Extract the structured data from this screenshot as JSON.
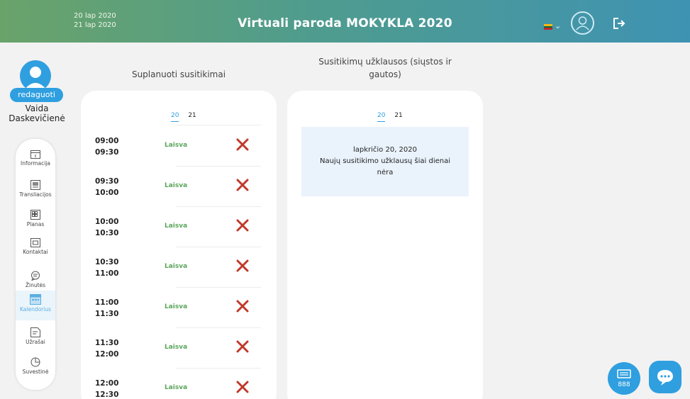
{
  "header": {
    "date_start": "20 lap 2020",
    "date_end": "21 lap 2020",
    "title": "Virtuali paroda MOKYKLA 2020",
    "lang_icon": "lithuania-flag-icon",
    "lang_chevron": "⌄"
  },
  "profile": {
    "edit_label": "redaguoti",
    "first_name": "Vaida",
    "last_name": "Daskevičienė"
  },
  "sidebar": {
    "items": [
      {
        "label": "Informacija",
        "icon": "info-icon"
      },
      {
        "label": "Transliacijos",
        "icon": "broadcast-icon"
      },
      {
        "label": "Planas",
        "icon": "plan-icon"
      },
      {
        "label": "Kontaktai",
        "icon": "contacts-icon"
      },
      {
        "label": "Žinutės",
        "icon": "messages-icon"
      },
      {
        "label": "Kalendorius",
        "icon": "calendar-icon"
      },
      {
        "label": "Užrašai",
        "icon": "notes-icon"
      },
      {
        "label": "Suvestinė",
        "icon": "summary-icon"
      }
    ]
  },
  "scheduled": {
    "title": "Suplanuoti susitikimai",
    "tabs": [
      "20",
      "21"
    ],
    "slots": [
      {
        "start": "09:00",
        "end": "09:30",
        "status": "Laisva"
      },
      {
        "start": "09:30",
        "end": "10:00",
        "status": "Laisva"
      },
      {
        "start": "10:00",
        "end": "10:30",
        "status": "Laisva"
      },
      {
        "start": "10:30",
        "end": "11:00",
        "status": "Laisva"
      },
      {
        "start": "11:00",
        "end": "11:30",
        "status": "Laisva"
      },
      {
        "start": "11:30",
        "end": "12:00",
        "status": "Laisva"
      },
      {
        "start": "12:00",
        "end": "12:30",
        "status": "Laisva"
      }
    ]
  },
  "requests": {
    "title_line1": "Susitikimų užklausos (siųstos ir",
    "title_line2": "gautos)",
    "tabs": [
      "20",
      "21"
    ],
    "date": "lapkričio 20, 2020",
    "empty_line1": "Naujų susitikimo užklausų šiai dienai",
    "empty_line2": "nėra"
  },
  "colors": {
    "accent": "#2f9fe0",
    "status_free": "#5aa55a",
    "delete": "#c0392b",
    "header_left": "#6aa36a",
    "header_right": "#3f93b2"
  },
  "fabs": [
    {
      "icon": "contacts-cards-icon"
    },
    {
      "icon": "chat-bubble-icon"
    }
  ]
}
